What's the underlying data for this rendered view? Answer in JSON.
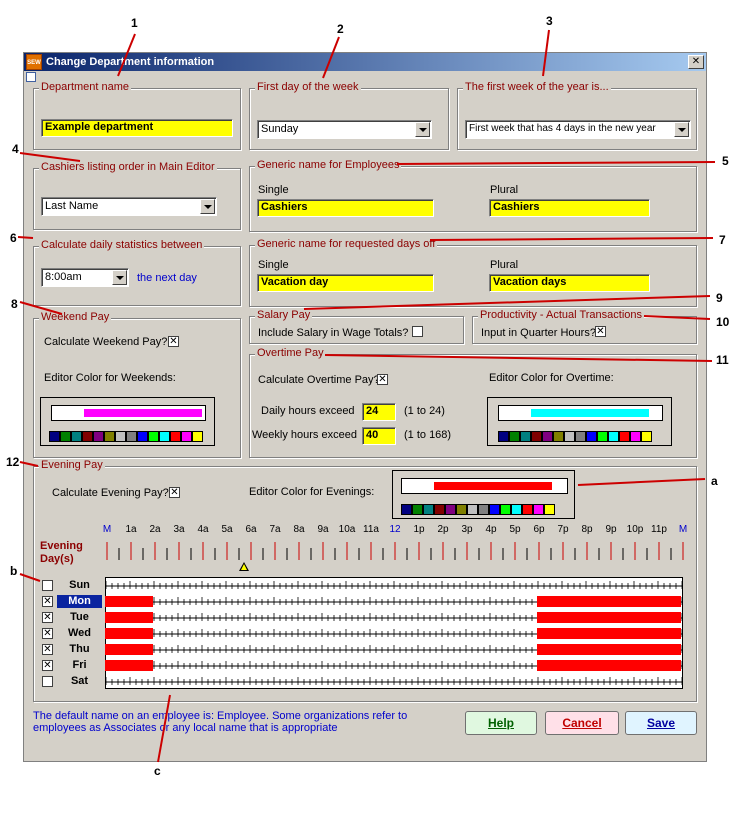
{
  "window": {
    "title": "Change Department information",
    "icon_text": "SEW",
    "close": "✕"
  },
  "callouts": {
    "n1": "1",
    "n2": "2",
    "n3": "3",
    "n4": "4",
    "n5": "5",
    "n6": "6",
    "n7": "7",
    "n8": "8",
    "n9": "9",
    "n10": "10",
    "n11": "11",
    "n12": "12",
    "a": "a",
    "b": "b",
    "c": "c"
  },
  "department": {
    "title": "Department name",
    "value": "Example department"
  },
  "first_day": {
    "title": "First day of the week",
    "value": "Sunday"
  },
  "first_week": {
    "title": "The first week of the year is...",
    "value": "First week that has 4 days in the new year"
  },
  "cashiers_order": {
    "title": "Cashiers listing order in Main Editor",
    "value": "Last Name"
  },
  "employees_name": {
    "title": "Generic name for Employees",
    "single_label": "Single",
    "single_value": "Cashiers",
    "plural_label": "Plural",
    "plural_value": "Cashiers"
  },
  "daily_stats": {
    "title": "Calculate daily statistics between",
    "value": "8:00am",
    "suffix": "the next day"
  },
  "days_off_name": {
    "title": "Generic name for requested days off",
    "single_label": "Single",
    "single_value": "Vacation day",
    "plural_label": "Plural",
    "plural_value": "Vacation days"
  },
  "weekend": {
    "title": "Weekend Pay",
    "calc_label": "Calculate Weekend Pay?",
    "color_label": "Editor Color for Weekends:",
    "checked": true,
    "bar_color": "#ff00ff"
  },
  "salary": {
    "title": "Salary Pay",
    "label": "Include Salary in Wage Totals?",
    "checked": false
  },
  "productivity": {
    "title": "Productivity - Actual Transactions",
    "label": "Input in Quarter Hours?",
    "checked": true
  },
  "overtime": {
    "title": "Overtime Pay",
    "calc_label": "Calculate Overtime Pay?",
    "checked": true,
    "color_label": "Editor Color for Overtime:",
    "daily_label": "Daily hours exceed",
    "daily_value": "24",
    "daily_range": "(1 to 24)",
    "weekly_label": "Weekly hours exceed",
    "weekly_value": "40",
    "weekly_range": "(1 to 168)",
    "bar_color": "#00ffff"
  },
  "evening": {
    "title": "Evening Pay",
    "calc_label": "Calculate Evening Pay?",
    "checked": true,
    "color_label": "Editor Color for Evenings:",
    "bar_color": "#ff0000",
    "heading_line1": "Evening",
    "heading_line2": "Day(s)"
  },
  "palette": [
    "#000080",
    "#008000",
    "#008080",
    "#800000",
    "#800080",
    "#808000",
    "#c0c0c0",
    "#808080",
    "#0000ff",
    "#00ff00",
    "#00ffff",
    "#ff0000",
    "#ff00ff",
    "#ffff00"
  ],
  "hours": [
    "M",
    "1a",
    "2a",
    "3a",
    "4a",
    "5a",
    "6a",
    "7a",
    "8a",
    "9a",
    "10a",
    "11a",
    "12",
    "1p",
    "2p",
    "3p",
    "4p",
    "5p",
    "6p",
    "7p",
    "8p",
    "9p",
    "10p",
    "11p",
    "M"
  ],
  "hours_blue": [
    0,
    12,
    24
  ],
  "days": [
    {
      "name": "Sun",
      "checked": false,
      "selected": false,
      "red": []
    },
    {
      "name": "Mon",
      "checked": true,
      "selected": true,
      "red": [
        [
          0,
          2
        ],
        [
          18,
          24
        ]
      ]
    },
    {
      "name": "Tue",
      "checked": true,
      "selected": false,
      "red": [
        [
          0,
          2
        ],
        [
          18,
          24
        ]
      ]
    },
    {
      "name": "Wed",
      "checked": true,
      "selected": false,
      "red": [
        [
          0,
          2
        ],
        [
          18,
          24
        ]
      ]
    },
    {
      "name": "Thu",
      "checked": true,
      "selected": false,
      "red": [
        [
          0,
          2
        ],
        [
          18,
          24
        ]
      ]
    },
    {
      "name": "Fri",
      "checked": true,
      "selected": false,
      "red": [
        [
          0,
          2
        ],
        [
          18,
          24
        ]
      ]
    },
    {
      "name": "Sat",
      "checked": false,
      "selected": false,
      "red": []
    }
  ],
  "footer": {
    "text": "The default name on an employee is: Employee.  Some organizations refer to employees as Associates or any local name that is appropriate"
  },
  "buttons": {
    "help": "Help",
    "cancel": "Cancel",
    "save": "Save"
  }
}
